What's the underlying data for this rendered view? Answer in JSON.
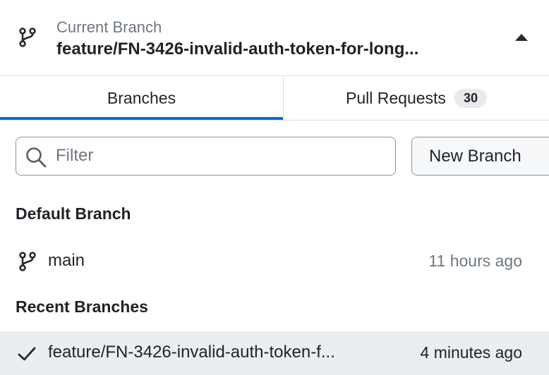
{
  "header": {
    "label": "Current Branch",
    "value": "feature/FN-3426-invalid-auth-token-for-long...",
    "icon": "git-branch-icon",
    "collapse_icon": "triangle-up-icon"
  },
  "tabs": [
    {
      "label": "Branches",
      "active": true
    },
    {
      "label": "Pull Requests",
      "badge": "30",
      "active": false
    }
  ],
  "filter": {
    "placeholder": "Filter",
    "value": "",
    "icon": "search-icon"
  },
  "new_branch": {
    "label": "New Branch"
  },
  "sections": [
    {
      "heading": "Default Branch",
      "items": [
        {
          "icon": "git-branch-icon",
          "name": "main",
          "time": "11 hours ago",
          "selected": false
        }
      ]
    },
    {
      "heading": "Recent Branches",
      "items": [
        {
          "icon": "check-icon",
          "name": "feature/FN-3426-invalid-auth-token-f...",
          "time": "4 minutes ago",
          "selected": true
        }
      ]
    }
  ],
  "colors": {
    "accent": "#0969da",
    "selected_row": "#eaeef2",
    "muted_text": "#6e7781",
    "border": "#d8dee4"
  }
}
